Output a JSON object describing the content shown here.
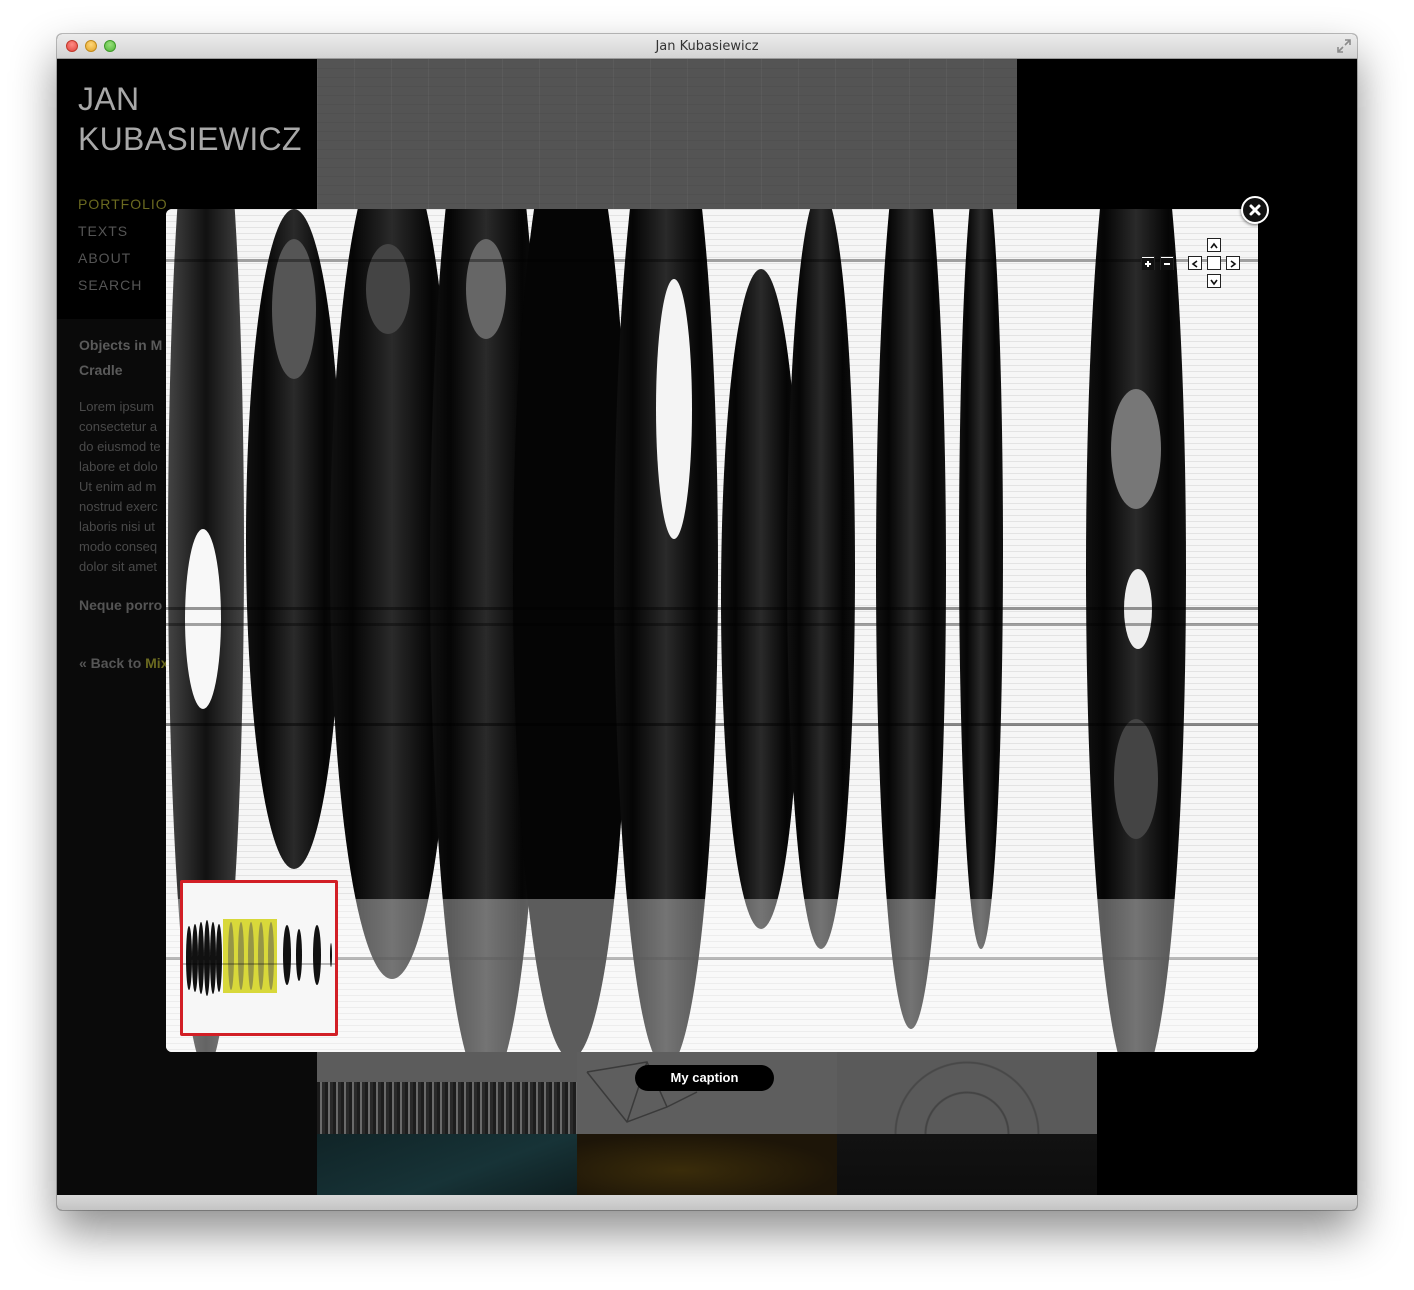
{
  "window": {
    "title": "Jan Kubasiewicz"
  },
  "site": {
    "title_line1": "JAN",
    "title_line2": "KUBASIEWICZ",
    "nav": [
      {
        "label": "PORTFOLIO",
        "active": true
      },
      {
        "label": "TEXTS",
        "active": false
      },
      {
        "label": "ABOUT",
        "active": false
      },
      {
        "label": "SEARCH",
        "active": false
      }
    ]
  },
  "article": {
    "title_line1": "Objects in M",
    "title_line2": "Cradle",
    "body_lines": [
      "Lorem ipsum",
      "consectetur a",
      "do eiusmod te",
      "labore et dolo",
      "Ut enim ad m",
      "nostrud exerc",
      "laboris nisi ut",
      "modo conseq",
      "dolor sit amet"
    ],
    "quote": "Neque porro",
    "back_prefix": "« Back to ",
    "back_link": "Mix"
  },
  "lightbox": {
    "caption": "My caption",
    "zoom_in_icon": "plus-icon",
    "zoom_out_icon": "minus-icon",
    "pan_up_icon": "chevron-up-icon",
    "pan_down_icon": "chevron-down-icon",
    "pan_left_icon": "chevron-left-icon",
    "pan_right_icon": "chevron-right-icon",
    "close_icon": "close-icon",
    "minimap_highlight_color": "#d8d83a",
    "minimap_border_color": "#d21f26"
  }
}
